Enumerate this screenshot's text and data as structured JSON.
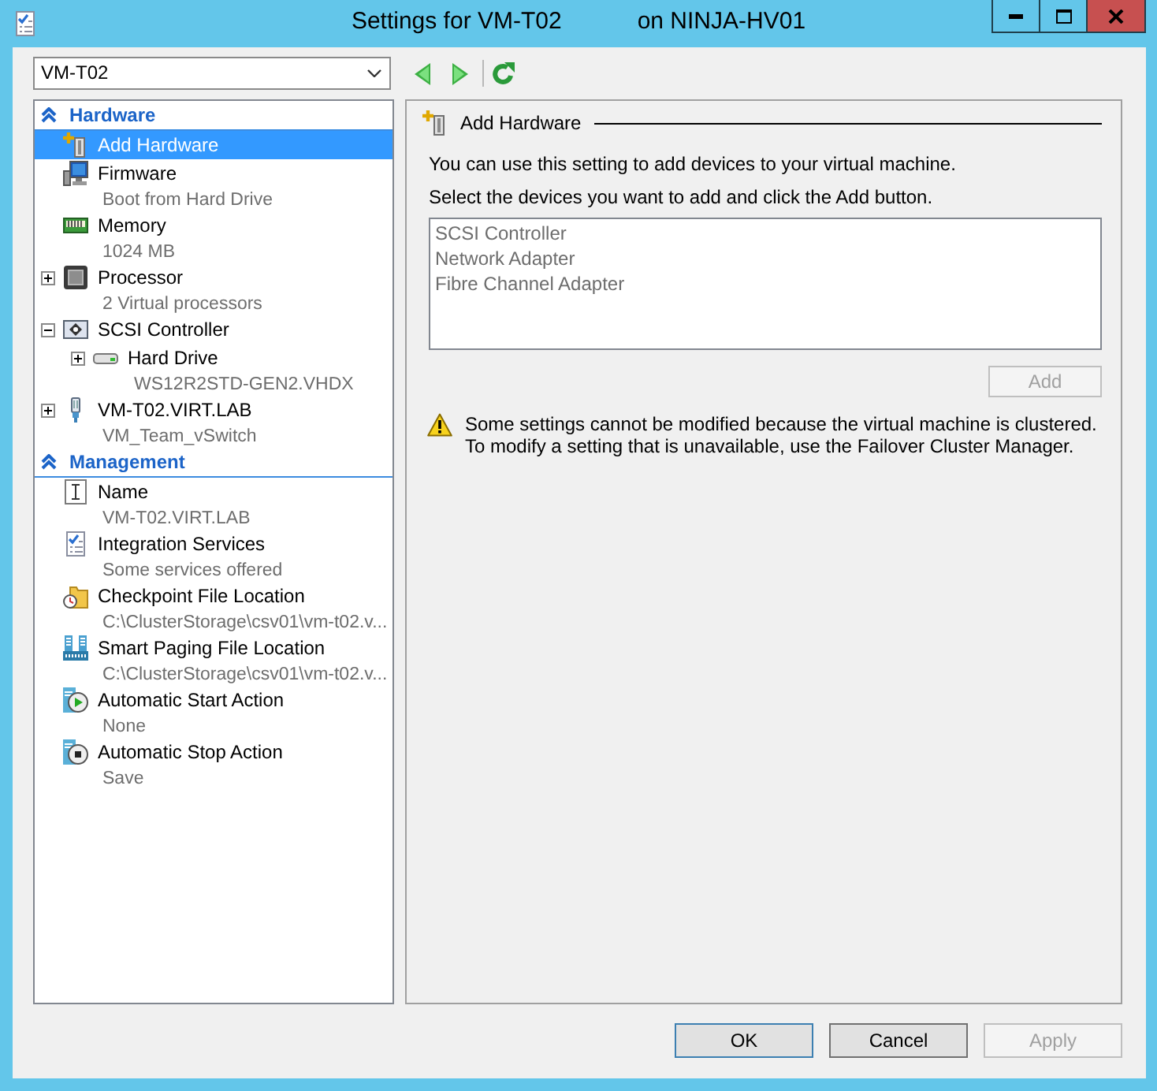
{
  "window": {
    "title": "Settings for VM-T02",
    "title_host": "on NINJA-HV01"
  },
  "toolbar": {
    "vm_select": {
      "value": "VM-T02"
    }
  },
  "sidebar": {
    "sections": [
      {
        "title": "Hardware",
        "expanded": true,
        "items": [
          {
            "kind": "add",
            "label": "Add Hardware",
            "selected": true
          },
          {
            "kind": "firmware",
            "label": "Firmware",
            "detail": "Boot from Hard Drive",
            "selected": false
          },
          {
            "kind": "memory",
            "label": "Memory",
            "detail": "1024 MB",
            "selected": false
          },
          {
            "kind": "processor",
            "label": "Processor",
            "detail": "2 Virtual processors",
            "expanded": false,
            "selected": false
          },
          {
            "kind": "controller",
            "label": "SCSI Controller",
            "expanded": true,
            "selected": false,
            "children": [
              {
                "kind": "drive",
                "label": "Hard Drive",
                "detail": "WS12R2STD-GEN2.VHDX",
                "expanded": false,
                "selected": false
              }
            ]
          },
          {
            "kind": "adapter",
            "label": "VM-T02.VIRT.LAB",
            "detail": "VM_Team_vSwitch",
            "expanded": false,
            "selected": false
          }
        ]
      },
      {
        "title": "Management",
        "expanded": true,
        "items": [
          {
            "kind": "name",
            "label": "Name",
            "detail": "VM-T02.VIRT.LAB",
            "selected": false
          },
          {
            "kind": "services",
            "label": "Integration Services",
            "detail": "Some services offered",
            "selected": false
          },
          {
            "kind": "checkpoint",
            "label": "Checkpoint File Location",
            "detail": "C:\\ClusterStorage\\csv01\\vm-t02.v...",
            "selected": false
          },
          {
            "kind": "paging",
            "label": "Smart Paging File Location",
            "detail": "C:\\ClusterStorage\\csv01\\vm-t02.v...",
            "selected": false
          },
          {
            "kind": "start",
            "label": "Automatic Start Action",
            "detail": "None",
            "selected": false
          },
          {
            "kind": "stop",
            "label": "Automatic Stop Action",
            "detail": "Save",
            "selected": false
          }
        ]
      }
    ]
  },
  "panel": {
    "title": "Add Hardware",
    "instructions": [
      "You can use this setting to add devices to your virtual machine.",
      "Select the devices you want to add and click the Add button."
    ],
    "device_list": {
      "disabled": true,
      "items": [
        "SCSI Controller",
        "Network Adapter",
        "Fibre Channel Adapter"
      ]
    },
    "add_button": {
      "label": "Add",
      "disabled": true
    },
    "warning": "Some settings cannot be modified because the virtual machine is clustered. To modify a setting that is unavailable, use the Failover Cluster Manager."
  },
  "buttons": [
    {
      "label": "OK",
      "default": true,
      "disabled": false
    },
    {
      "label": "Cancel",
      "default": false,
      "disabled": false
    },
    {
      "label": "Apply",
      "default": false,
      "disabled": true
    }
  ]
}
